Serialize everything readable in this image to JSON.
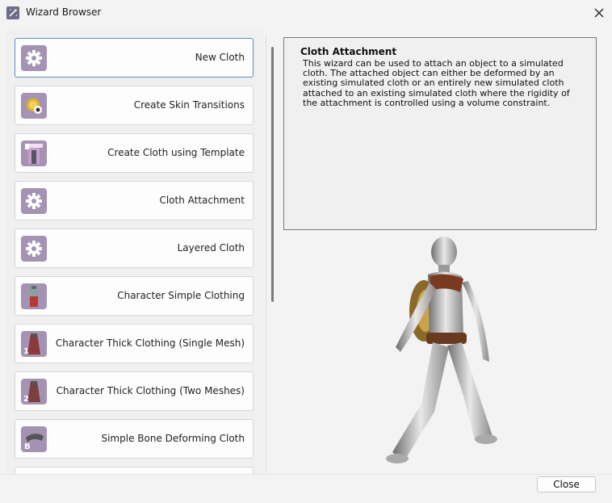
{
  "window": {
    "title": "Wizard Browser"
  },
  "wizards": [
    {
      "label": "New Cloth",
      "icon": "gear-icon",
      "selected": true
    },
    {
      "label": "Create Skin Transitions",
      "icon": "skin-transition-icon",
      "selected": false
    },
    {
      "label": "Create Cloth using Template",
      "icon": "cloth-template-icon",
      "selected": false
    },
    {
      "label": "Cloth Attachment",
      "icon": "gear-icon",
      "selected": false
    },
    {
      "label": "Layered Cloth",
      "icon": "gear-icon",
      "selected": false
    },
    {
      "label": "Character Simple Clothing",
      "icon": "simple-clothing-icon",
      "selected": false
    },
    {
      "label": "Character Thick Clothing (Single Mesh)",
      "icon": "thick-clothing-single-icon",
      "badge": "1",
      "selected": false
    },
    {
      "label": "Character Thick Clothing (Two Meshes)",
      "icon": "thick-clothing-two-icon",
      "badge": "2",
      "selected": false
    },
    {
      "label": "Simple Bone Deforming Cloth",
      "icon": "bone-deform-icon",
      "badge": "B",
      "selected": false
    }
  ],
  "description": {
    "title": "Cloth Attachment",
    "body": "This wizard can be used to attach an object to a simulated cloth. The attached object can either be deformed by an existing simulated cloth or an entirely new simulated cloth attached to an existing simulated cloth where the rigidity of the attachment is controlled using a volume constraint."
  },
  "footer": {
    "close_label": "Close"
  },
  "colors": {
    "accent": "#5c8fbf",
    "icon_bg": "#a493b3"
  }
}
